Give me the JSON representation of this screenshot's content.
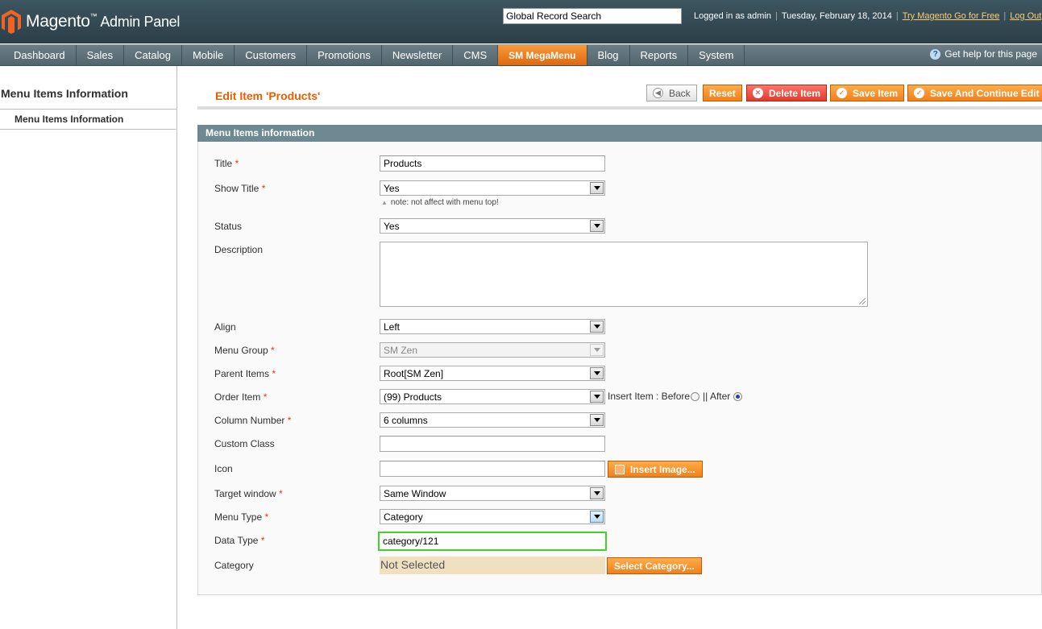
{
  "header": {
    "app_name": "Magento",
    "trademark": "™",
    "app_sub": "Admin Panel",
    "search_placeholder": "Global Record Search",
    "logged_in": "Logged in as admin",
    "date": "Tuesday, February 18, 2014",
    "try_link": "Try Magento Go for Free",
    "logout_link": "Log Out"
  },
  "nav": {
    "items": [
      "Dashboard",
      "Sales",
      "Catalog",
      "Mobile",
      "Customers",
      "Promotions",
      "Newsletter",
      "CMS",
      "SM MegaMenu",
      "Blog",
      "Reports",
      "System"
    ],
    "active": "SM MegaMenu",
    "help": "Get help for this page"
  },
  "sidebar": {
    "title": "Menu Items Information",
    "tab": "Menu Items Information"
  },
  "content": {
    "title": "Edit Item 'Products'",
    "buttons": {
      "back": "Back",
      "reset": "Reset",
      "delete": "Delete Item",
      "save": "Save Item",
      "save_continue": "Save And Continue Edit"
    },
    "section_title": "Menu Items information"
  },
  "form": {
    "required_mark": "*",
    "title": {
      "label": "Title",
      "value": "Products"
    },
    "show_title": {
      "label": "Show Title",
      "value": "Yes",
      "note": "note: not affect with menu top!"
    },
    "status": {
      "label": "Status",
      "value": "Yes"
    },
    "description": {
      "label": "Description",
      "value": ""
    },
    "align": {
      "label": "Align",
      "value": "Left"
    },
    "menu_group": {
      "label": "Menu Group",
      "value": "SM Zen"
    },
    "parent_items": {
      "label": "Parent Items",
      "value": "Root[SM Zen]"
    },
    "order_item": {
      "label": "Order Item",
      "value": "(99) Products",
      "insert_label": "Insert Item : Before",
      "after_label": "|| After",
      "selected": "After"
    },
    "column_number": {
      "label": "Column Number",
      "value": "6 columns"
    },
    "custom_class": {
      "label": "Custom Class",
      "value": ""
    },
    "icon": {
      "label": "Icon",
      "value": "",
      "button": "Insert Image..."
    },
    "target_window": {
      "label": "Target window",
      "value": "Same Window"
    },
    "menu_type": {
      "label": "Menu Type",
      "value": "Category"
    },
    "data_type": {
      "label": "Data Type",
      "value": "category/121"
    },
    "category": {
      "label": "Category",
      "value": "Not Selected",
      "button": "Select Category..."
    }
  },
  "colors": {
    "accent": "#eb5e00",
    "header_bg": "#2b3f48",
    "nav_active": "#f0801c",
    "section_head": "#6f8992",
    "highlight": "#43d02a"
  }
}
